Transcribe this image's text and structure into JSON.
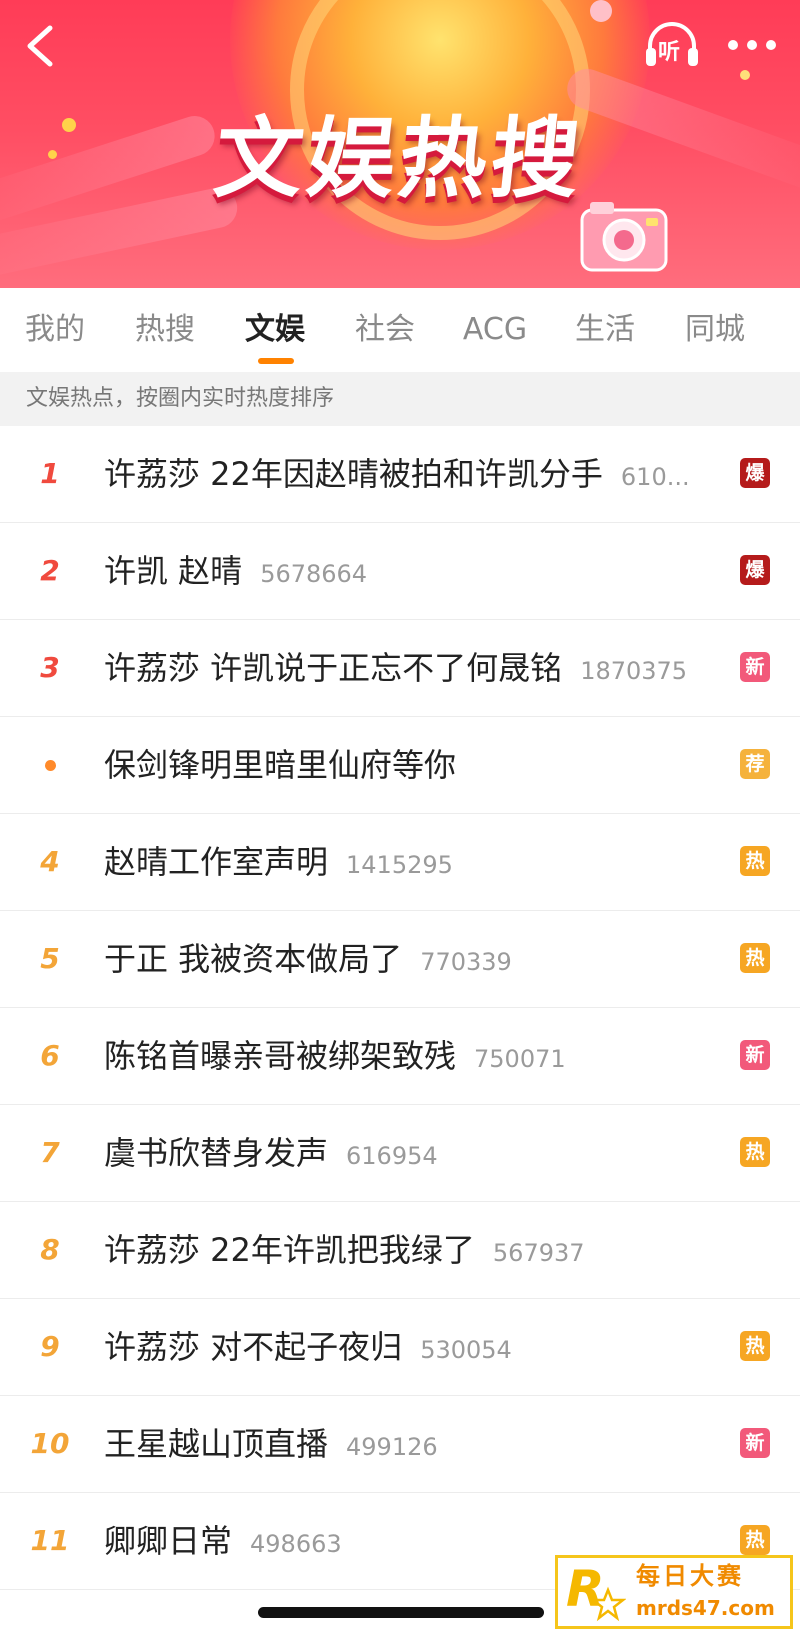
{
  "banner": {
    "title": "文娱热搜",
    "listen_label": "听"
  },
  "tabs": [
    {
      "label": "我的"
    },
    {
      "label": "热搜"
    },
    {
      "label": "文娱",
      "active": true
    },
    {
      "label": "社会"
    },
    {
      "label": "ACG"
    },
    {
      "label": "生活"
    },
    {
      "label": "同城"
    }
  ],
  "subheader": "文娱热点，按圈内实时热度排序",
  "list": [
    {
      "rank": "1",
      "title": "许荔莎 22年因赵晴被拍和许凯分手",
      "count": "610...",
      "badge": "爆"
    },
    {
      "rank": "2",
      "title": "许凯 赵晴",
      "count": "5678664",
      "badge": "爆"
    },
    {
      "rank": "3",
      "title": "许荔莎 许凯说于正忘不了何晟铭",
      "count": "1870375",
      "badge": "新"
    },
    {
      "rank": "•",
      "title": "保剑锋明里暗里仙府等你",
      "count": "",
      "badge": "荐"
    },
    {
      "rank": "4",
      "title": "赵晴工作室声明",
      "count": "1415295",
      "badge": "热"
    },
    {
      "rank": "5",
      "title": "于正 我被资本做局了",
      "count": "770339",
      "badge": "热"
    },
    {
      "rank": "6",
      "title": "陈铭首曝亲哥被绑架致残",
      "count": "750071",
      "badge": "新"
    },
    {
      "rank": "7",
      "title": "虞书欣替身发声",
      "count": "616954",
      "badge": "热"
    },
    {
      "rank": "8",
      "title": "许荔莎 22年许凯把我绿了",
      "count": "567937",
      "badge": ""
    },
    {
      "rank": "9",
      "title": "许荔莎 对不起子夜归",
      "count": "530054",
      "badge": "热"
    },
    {
      "rank": "10",
      "title": "王星越山顶直播",
      "count": "499126",
      "badge": "新"
    },
    {
      "rank": "11",
      "title": "卿卿日常",
      "count": "498663",
      "badge": "热"
    }
  ],
  "watermark": {
    "line1": "每日大赛",
    "line2": "mrds47.com"
  },
  "colors": {
    "accent": "#ff8200",
    "rank_top": "#f04a3e",
    "rank_mid": "#f3a538",
    "badge_bao": "#b51b1b",
    "badge_xin": "#f2597a",
    "badge_jian": "#f5b23c",
    "badge_re": "#f6a623"
  }
}
